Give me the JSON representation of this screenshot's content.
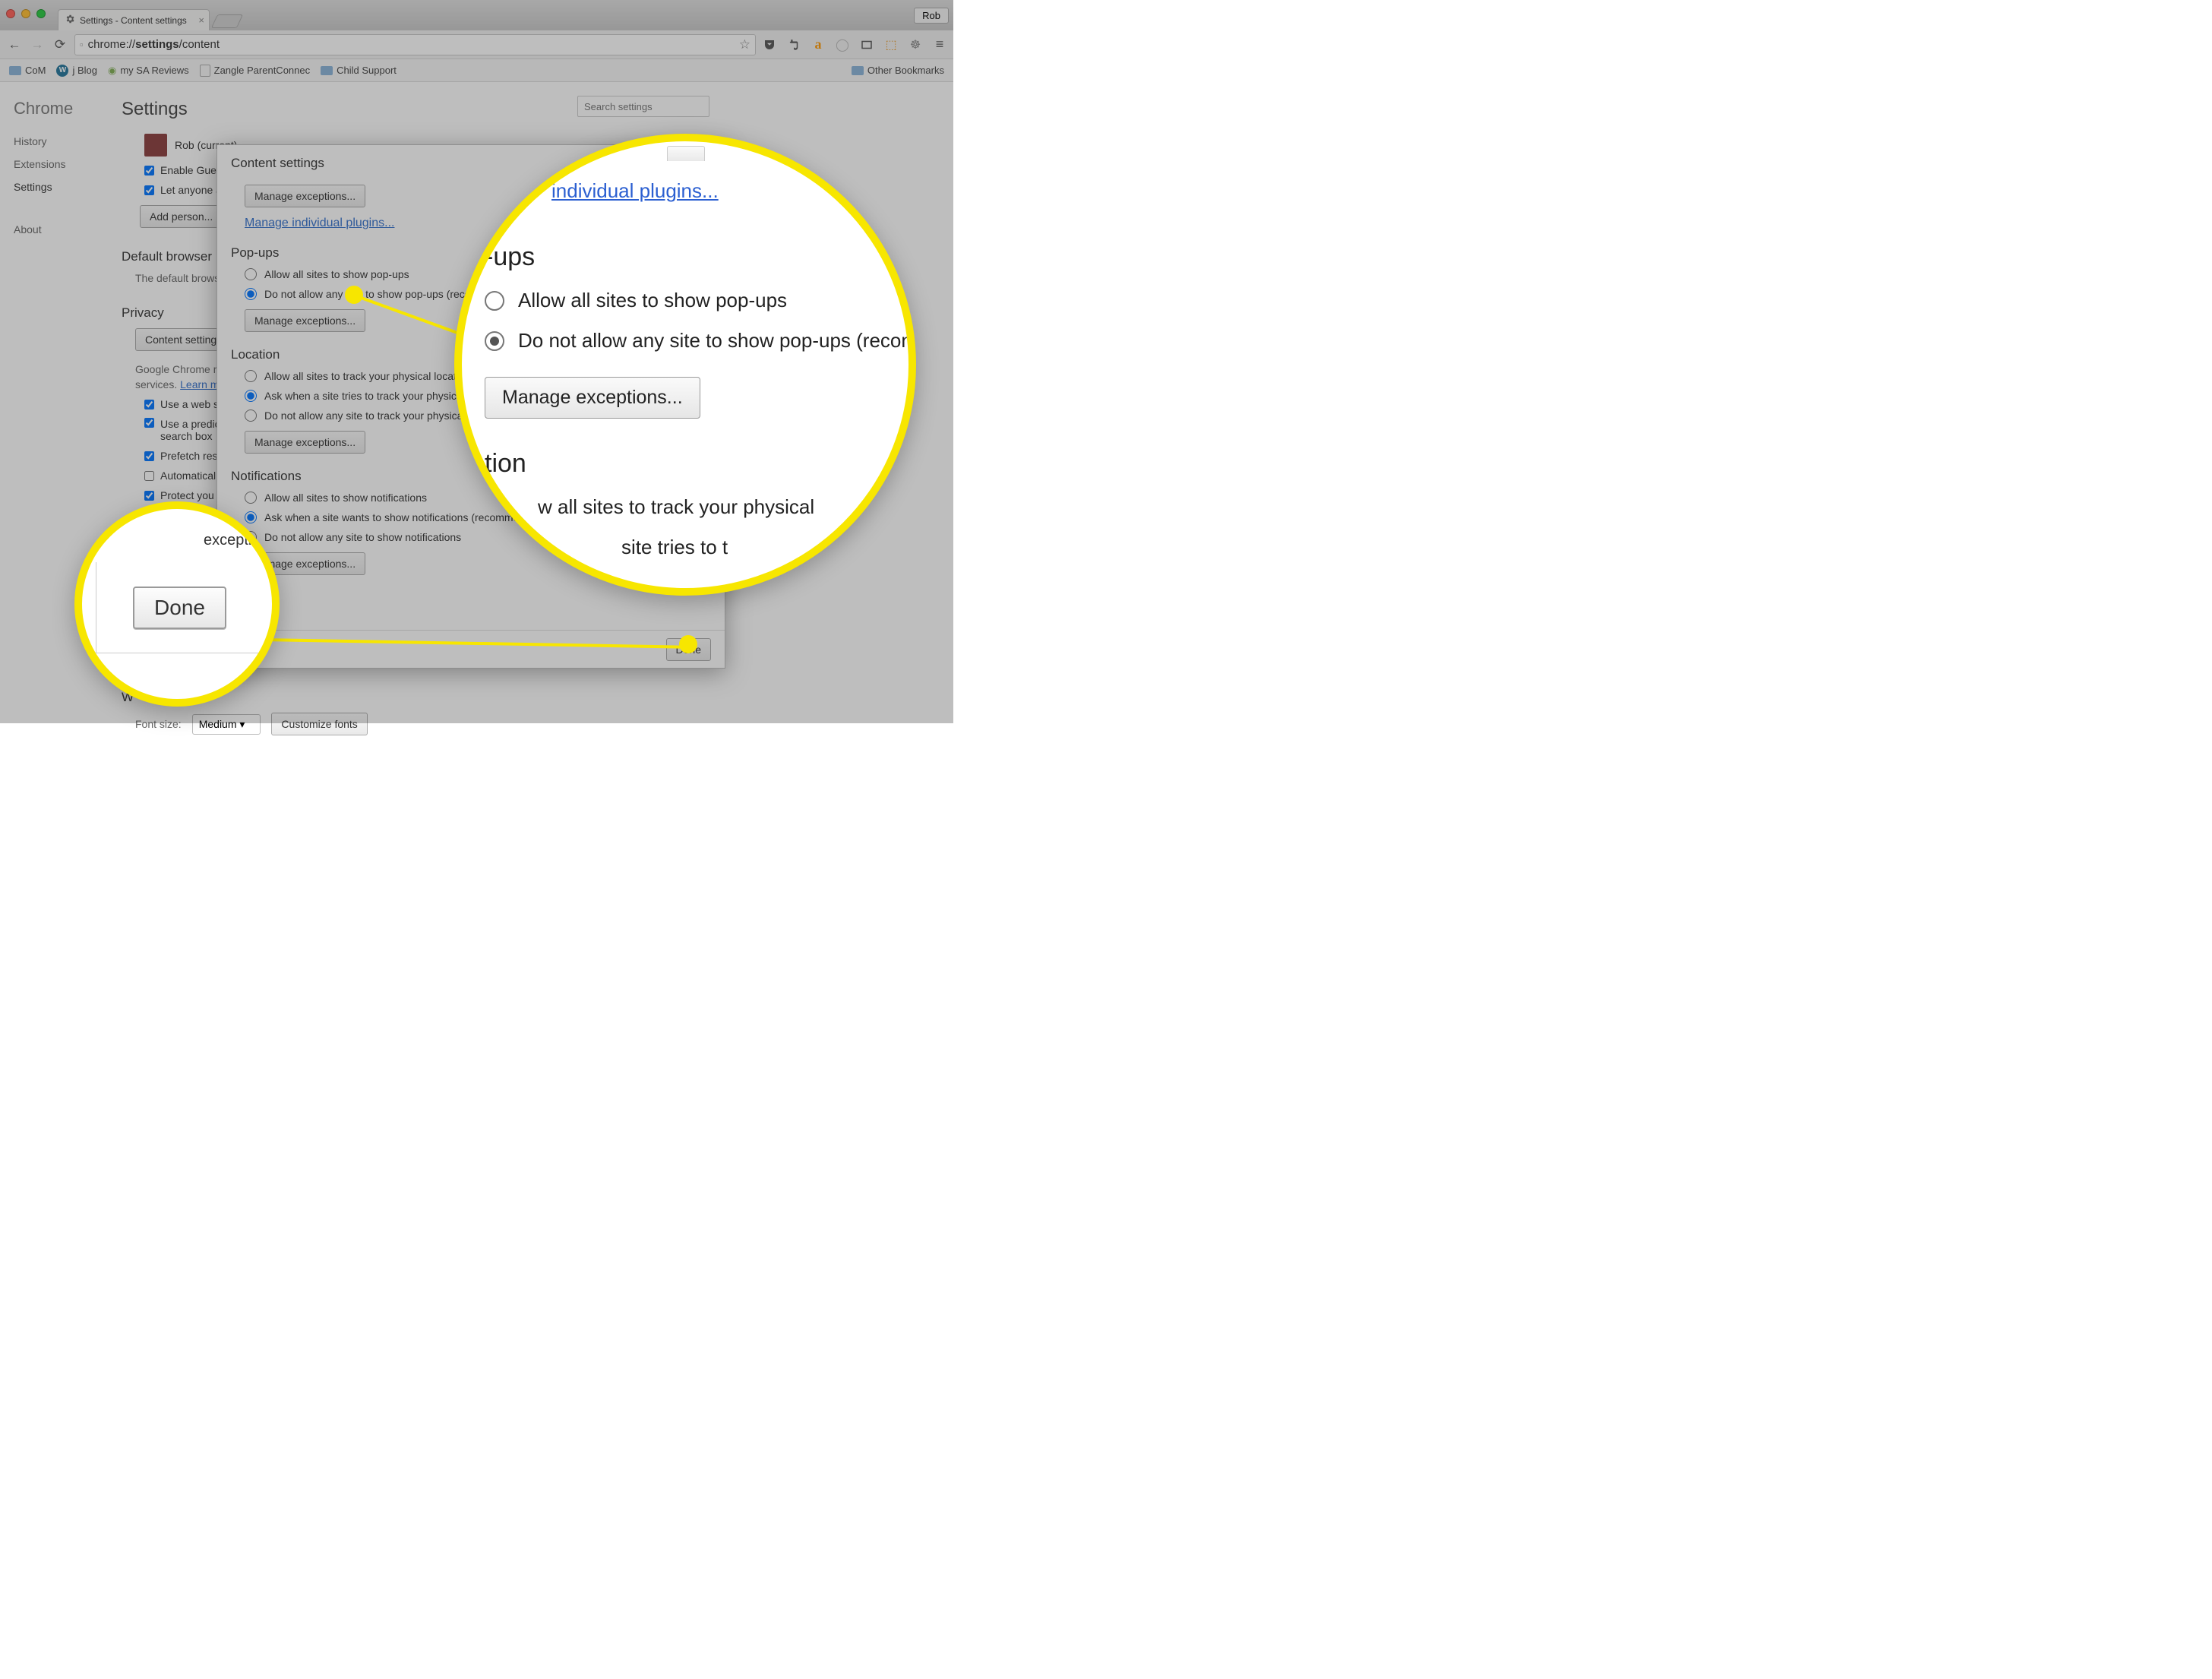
{
  "window": {
    "tab_title": "Settings - Content settings",
    "profile_button": "Rob",
    "url_display_prefix": "chrome://",
    "url_display_bold": "settings",
    "url_display_suffix": "/content"
  },
  "bookmarks": {
    "items": [
      "CoM",
      "j Blog",
      "my SA Reviews",
      "Zangle ParentConnec",
      "Child Support"
    ],
    "other": "Other Bookmarks"
  },
  "sidebar": {
    "title": "Chrome",
    "links": {
      "history": "History",
      "extensions": "Extensions",
      "settings": "Settings",
      "about": "About"
    }
  },
  "settings": {
    "header": "Settings",
    "search_placeholder": "Search settings",
    "profile_label": "Rob (current)",
    "guest": "Enable Guest",
    "anyone": "Let anyone ad",
    "add_person": "Add person...",
    "default_browser_h": "Default browser",
    "default_browser_t": "The default brows",
    "privacy_h": "Privacy",
    "content_settings_btn": "Content settings",
    "privacy_blurb1": "Google Chrome m",
    "privacy_blurb2_prefix": "services. ",
    "privacy_learn": "Learn mo",
    "chk_webservice": "Use a web ser",
    "chk_prediction1": "Use a predictio",
    "chk_prediction2": "search box",
    "chk_prefetch": "Prefetch reso",
    "chk_auto": "Automatically",
    "chk_protect": "Protect you a",
    "webcontent_h": "W",
    "font_label": "Font size:",
    "font_value": "Medium",
    "customize_fonts": "Customize fonts"
  },
  "modal": {
    "title": "Content settings",
    "manage_exceptions": "Manage exceptions...",
    "manage_plugins": "Manage individual plugins...",
    "popups_h": "Pop-ups",
    "popups_allow": "Allow all sites to show pop-ups",
    "popups_block": "Do not allow any site to show pop-ups (recommended)",
    "location_h": "Location",
    "loc_allow": "Allow all sites to track your physical location",
    "loc_ask": "Ask when a site tries to track your physical location",
    "loc_block": "Do not allow any site to track your physical location",
    "notif_h": "Notifications",
    "notif_allow": "Allow all sites to show notifications",
    "notif_ask": "Ask when a site wants to show notifications (recommended)",
    "notif_block": "Do not allow any site to show notifications",
    "done": "Done"
  },
  "zoom_big": {
    "plugins_link": "individual plugins...",
    "popups_h": "-ups",
    "popups_allow": "Allow all sites to show pop-ups",
    "popups_block": "Do not allow any site to show pop-ups (recon",
    "manage_exceptions": "Manage exceptions...",
    "location_h": "tion",
    "loc_allow": "w all sites to track your physical",
    "loc_ask": "site tries to t"
  },
  "zoom_small": {
    "done": "Done",
    "exceptions_tail": "exceptions..."
  }
}
